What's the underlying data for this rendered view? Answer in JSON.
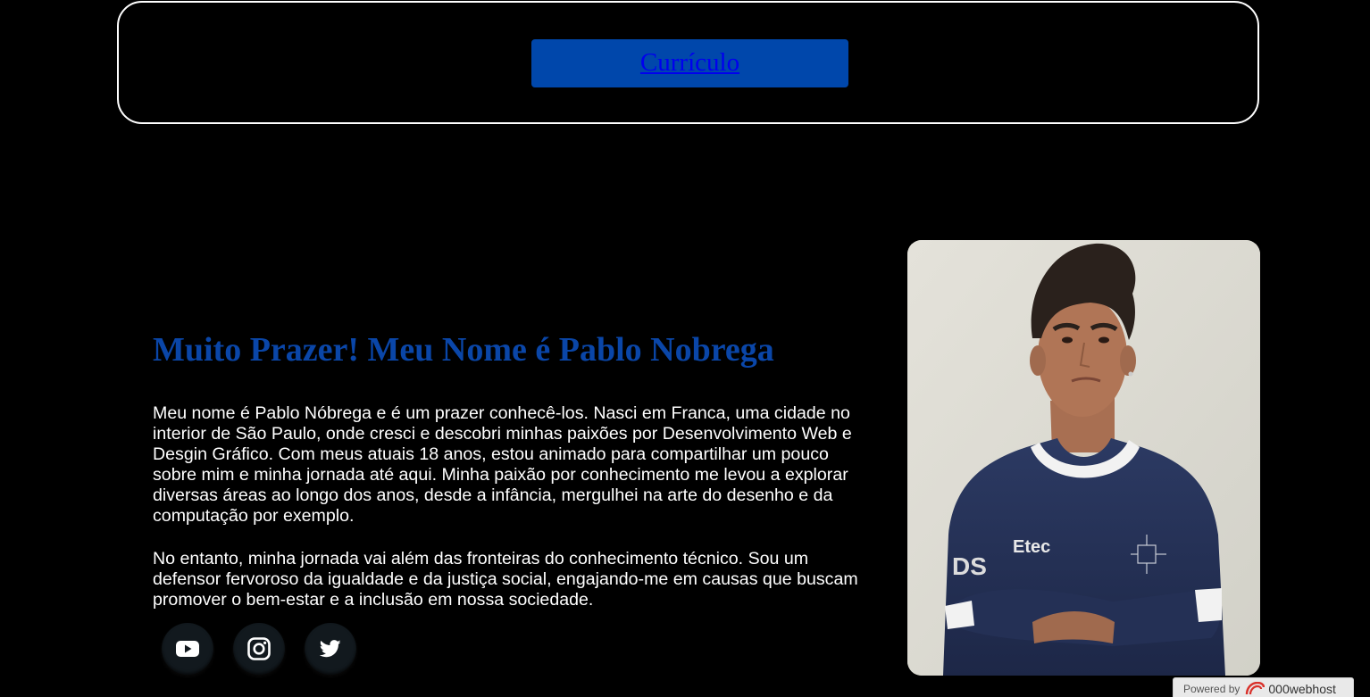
{
  "nav": {
    "cv_label": "Currículo"
  },
  "intro": {
    "heading": "Muito Prazer! Meu Nome é Pablo Nobrega",
    "paragraph1": "Meu nome é Pablo Nóbrega e é um prazer conhecê-los. Nasci em Franca, uma cidade no interior de São Paulo, onde cresci e descobri minhas paixões por Desenvolvimento Web e Desgin Gráfico. Com meus atuais 18 anos, estou animado para compartilhar um pouco sobre mim e minha jornada até aqui. Minha paixão por conhecimento me levou a explorar diversas áreas ao longo dos anos, desde a infância, mergulhei na arte do desenho e da computação por exemplo.",
    "paragraph2": "No entanto, minha jornada vai além das fronteiras do conhecimento técnico. Sou um defensor fervoroso da igualdade e da justiça social, engajando-me em causas que buscam promover o bem-estar e a inclusão em nossa sociedade."
  },
  "socials": [
    {
      "icon": "youtube-icon"
    },
    {
      "icon": "instagram-icon"
    },
    {
      "icon": "twitter-icon"
    }
  ],
  "photo": {
    "subject": "portrait-photo",
    "shirt_text": "Etec",
    "shirt_text_2": "DS"
  },
  "footer": {
    "powered_label": "Powered by",
    "brand": "000webhost"
  },
  "colors": {
    "background": "#000000",
    "accent": "#0a46a8",
    "button": "#0047ab",
    "link": "#0000ee"
  }
}
